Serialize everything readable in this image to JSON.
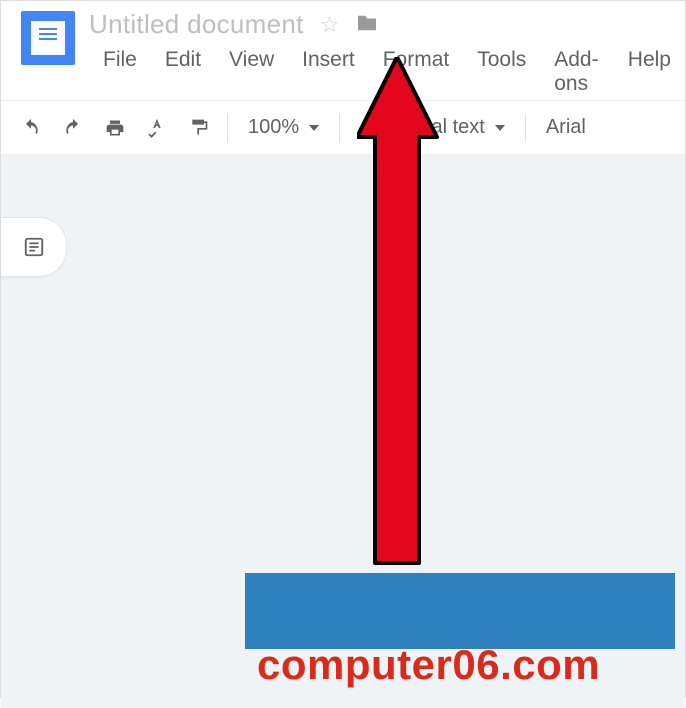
{
  "header": {
    "doc_title": "Untitled document",
    "star_icon": "☆",
    "folder_icon": "■"
  },
  "menubar": {
    "items": [
      "File",
      "Edit",
      "View",
      "Insert",
      "Format",
      "Tools",
      "Add-ons",
      "Help"
    ]
  },
  "toolbar": {
    "zoom": "100%",
    "style": "rmal text",
    "font": "Arial"
  },
  "watermark": {
    "text": "computer06.com"
  }
}
